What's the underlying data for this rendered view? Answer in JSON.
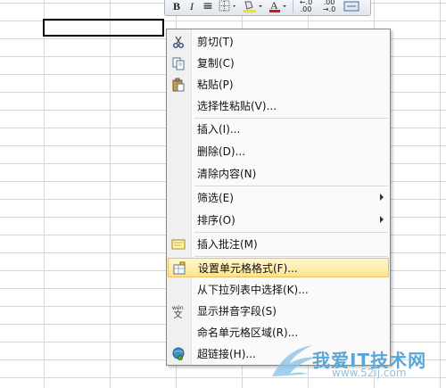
{
  "mini_toolbar": {
    "bold": "B",
    "italic": "I",
    "align": "≡",
    "font_color": "A",
    "inc_decimal": "←.0\n.00",
    "dec_decimal": ".00\n→.0"
  },
  "context_menu": {
    "items": [
      {
        "label": "剪切(T)",
        "icon": "scissors-icon"
      },
      {
        "label": "复制(C)",
        "icon": "copy-icon"
      },
      {
        "label": "粘贴(P)",
        "icon": "paste-icon"
      },
      {
        "label": "选择性粘贴(V)...",
        "icon": ""
      },
      {
        "label": "插入(I)...",
        "icon": ""
      },
      {
        "label": "删除(D)...",
        "icon": ""
      },
      {
        "label": "清除内容(N)",
        "icon": ""
      },
      {
        "label": "筛选(E)",
        "icon": "",
        "submenu": true
      },
      {
        "label": "排序(O)",
        "icon": "",
        "submenu": true
      },
      {
        "label": "插入批注(M)",
        "icon": "comment-icon"
      },
      {
        "label": "设置单元格格式(F)...",
        "icon": "format-cells-icon",
        "highlighted": true
      },
      {
        "label": "从下拉列表中选择(K)...",
        "icon": ""
      },
      {
        "label": "显示拼音字段(S)",
        "icon": "phonetic-icon"
      },
      {
        "label": "命名单元格区域(R)...",
        "icon": ""
      },
      {
        "label": "超链接(H)...",
        "icon": "hyperlink-icon"
      }
    ]
  },
  "watermark": {
    "text": "我爱IT技术网",
    "sub": "www.52ij.com"
  },
  "colors": {
    "highlight": "#ffe392",
    "grid": "#d0d7e5",
    "font_color_bar": "#d01919",
    "fill_color_bar": "#f2e600"
  }
}
